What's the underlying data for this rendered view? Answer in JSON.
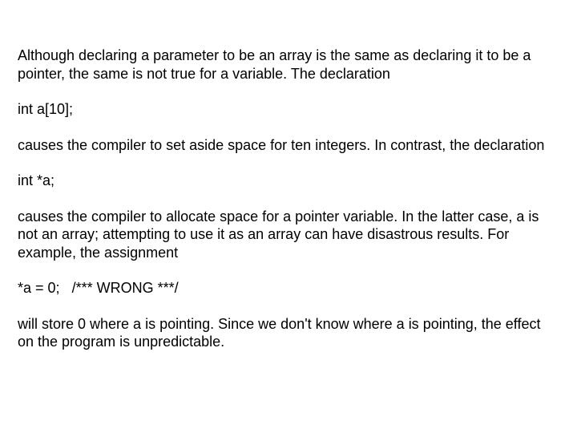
{
  "p1": "Although declaring a parameter to be an array is the same as declaring it to be a pointer, the same is not true for a variable. The declaration",
  "c1": "int a[10];",
  "p2": "causes the compiler to set aside space for ten integers. In contrast, the declaration",
  "c2": "int *a;",
  "p3": "causes the compiler to allocate space for a pointer variable. In the latter case, a is not an array; attempting to use it as an array can have disastrous results. For example, the assignment",
  "c3a": "*a = 0;",
  "c3b": "/*** WRONG ***/",
  "p4": "will store 0 where a is pointing. Since we don't know where a is pointing, the effect on the program is unpredictable."
}
